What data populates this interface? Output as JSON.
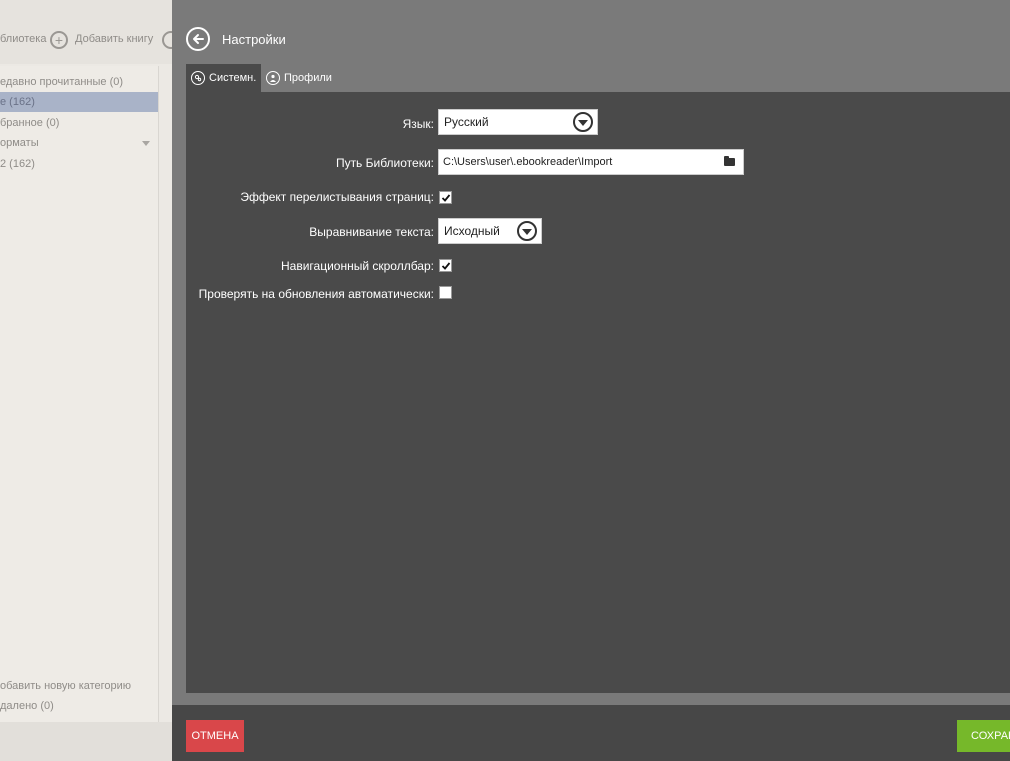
{
  "background_app": {
    "toolbar": {
      "library_label": "блиотека",
      "add_book_label": "Добавить книгу"
    },
    "sidebar": {
      "items": [
        {
          "label": "едавно прочитанные (0)"
        },
        {
          "label": "е (162)"
        },
        {
          "label": "бранное (0)"
        },
        {
          "label": "орматы"
        },
        {
          "label": "2 (162)"
        }
      ],
      "add_category_label": "обавить новую категорию",
      "deleted_label": "далено (0)"
    }
  },
  "settings": {
    "title": "Настройки",
    "tabs": [
      {
        "label": "Системн."
      },
      {
        "label": "Профили"
      }
    ],
    "language": {
      "label": "Язык:",
      "value": "Русский"
    },
    "library_path": {
      "label": "Путь Библиотеки:",
      "value": "C:\\Users\\user\\.ebookreader\\Import"
    },
    "page_flip_effect": {
      "label": "Эффект перелистывания страниц:",
      "checked": true
    },
    "text_alignment": {
      "label": "Выравнивание текста:",
      "value": "Исходный"
    },
    "nav_scrollbar": {
      "label": "Навигационный скроллбар:",
      "checked": true
    },
    "auto_update": {
      "label": "Проверять на обновления автоматически:",
      "checked": false
    },
    "cancel_label": "ОТМЕНА",
    "save_label": "СОХРАН"
  },
  "colors": {
    "cancel": "#d9474a",
    "save": "#76b82a",
    "panel": "#4a4a4a",
    "overlay": "#7a7a7a"
  }
}
